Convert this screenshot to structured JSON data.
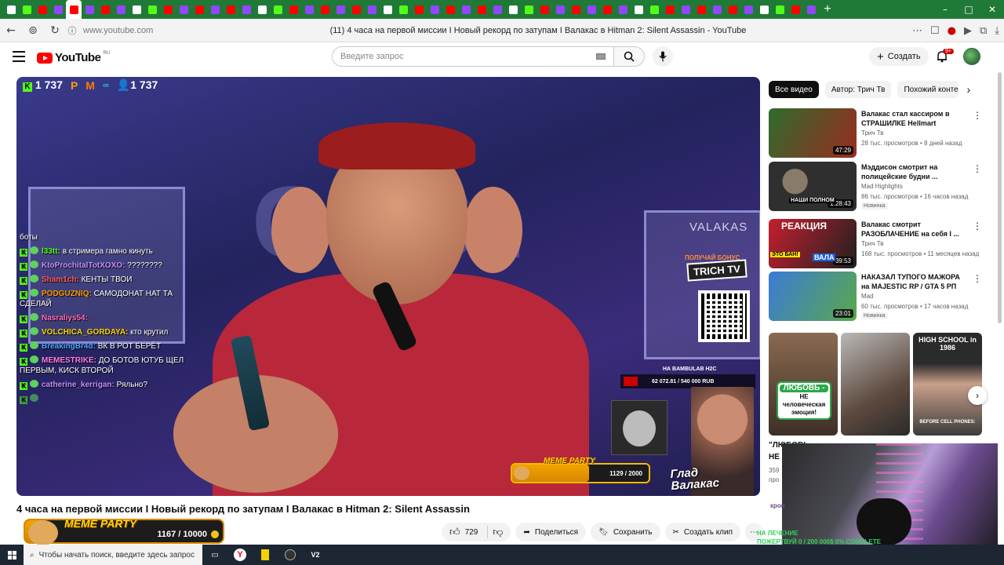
{
  "browser": {
    "tabs_count": 52,
    "url": "www.youtube.com",
    "page_title": "(11) 4 часа на первой миссии I Новый рекорд по затупам I Валакас в Hitman 2: Silent Assassin - YouTube"
  },
  "header": {
    "logo_text": "YouTube",
    "logo_region": "RU",
    "search_placeholder": "Введите запрос",
    "create_label": "Создать",
    "notifications_badge": "9+"
  },
  "player": {
    "viewer_count_kick": "1 737",
    "viewer_count_total": "1 737",
    "bg_letters": "G   S.",
    "channel_tag": "VALAKAS",
    "promo_text": "ПОЛУЧАЙ БОНУС",
    "promo_brand": "TRICH TV",
    "donate_label": "НА BAMBULAB H2C",
    "donate_value": "62 072.81 / 540 000 RUB",
    "meme_title": "MEME PARTY",
    "meme_count": "1129 / 2000",
    "meme_progress": 0.5645,
    "glad_line1": "Глад",
    "glad_line2": "Валакас",
    "chat": [
      {
        "name": "",
        "text": "боты"
      },
      {
        "name": "l33tt:",
        "text": "в стримера гамно кинуть"
      },
      {
        "name": "KtoProchitalTotXOXO:",
        "text": "????????"
      },
      {
        "name": "Sham1ch:",
        "text": "КЕНТЫ ТВОИ"
      },
      {
        "name": "PODGUZNIQ:",
        "text": "САМОДОНАТ НАТ ТА СДЕЛАЙ"
      },
      {
        "name": "Nasraliys54:",
        "text": ""
      },
      {
        "name": "VOLCHICA_GORDAYA:",
        "text": "кто крутил"
      },
      {
        "name": "BreakingBr4d:",
        "text": "ВК В РОТ БЕРЁТ"
      },
      {
        "name": "MEMESTRIKE:",
        "text": "ДО БОТОВ ЮТУБ ЩЕЛ ПЕРВЫМ, КИСК ВТОРОЙ"
      },
      {
        "name": "catherine_kerrigan:",
        "text": "Ряльно?"
      },
      {
        "name": "",
        "text": ""
      }
    ]
  },
  "video": {
    "title": "4 часа на первой миссии I Новый рекорд по затупам I Валакас в Hitman 2: Silent Assassin",
    "likes": "729",
    "share_label": "Поделиться",
    "save_label": "Сохранить",
    "clip_label": "Создать клип",
    "more_label": "⋯"
  },
  "meme_widget": {
    "title": "MEME PARTY",
    "count": "1167 / 10000",
    "progress": 0.1167
  },
  "chips": [
    "Все видео",
    "Автор: Трич Тв",
    "Похожий контент"
  ],
  "recommendations": [
    {
      "title": "Валакас стал кассиром в СТРАШИЛКЕ Hellmart",
      "channel": "Трич Тв",
      "meta": "28 тыс. просмотров • 8 дней назад",
      "badge": "",
      "duration": "47:29",
      "color_a": "#2e6b2e",
      "color_b": "#9a2c1f"
    },
    {
      "title": "Мэддисон смотрит на полицейские будни ...",
      "channel": "Mad Highlights",
      "meta": "86 тыс. просмотров • 16 часов назад",
      "badge": "Новинка",
      "duration": "1:28:43",
      "color_a": "#2f2f2f",
      "color_b": "#6a6a6a"
    },
    {
      "title": "Валакас смотрит РАЗОБЛАЧЕНИЕ на себя I ...",
      "channel": "Трич Тв",
      "meta": "168 тыс. просмотров • 11 месяцев назад",
      "badge": "",
      "duration": "39:53",
      "color_a": "#c41f2f",
      "color_b": "#202020"
    },
    {
      "title": "НАКАЗАЛ ТУПОГО МАЖОРА на MAJESTIC RP / GTA 5 РП",
      "channel": "Mad",
      "meta": "60 тыс. просмотров • 17 часов назад",
      "badge": "Новинка",
      "duration": "23:01",
      "color_a": "#3b7bd6",
      "color_b": "#5aa84a"
    }
  ],
  "thumb_labels": {
    "second": "НАШИ ПОЛНОМ",
    "third_top": "РЕАКЦИЯ",
    "third_mid": "ЭТО БАН!",
    "third_side": "ВАЛА"
  },
  "shorts": {
    "love_title": "ЛЮБОВЬ -",
    "love_text": "НЕ человеческая эмоция!",
    "hs_title": "HIGH SCHOOL in 1986",
    "hs_bottom": "BEFORE CELL PHONES:",
    "caption1": "\"ЛЮБОВЬ –",
    "caption2": "НЕ",
    "views": "359",
    "views2": "про"
  },
  "webcam": {
    "caption": "кров"
  },
  "overlay": {
    "line1": "НА ЛЕЧЕНИЕ",
    "line2": "ПОЖЕРТВУЙ 0 / 200 000$    0% COMPLETE"
  },
  "taskbar": {
    "search_placeholder": "Чтобы начать поиск, введите здесь запрос"
  }
}
